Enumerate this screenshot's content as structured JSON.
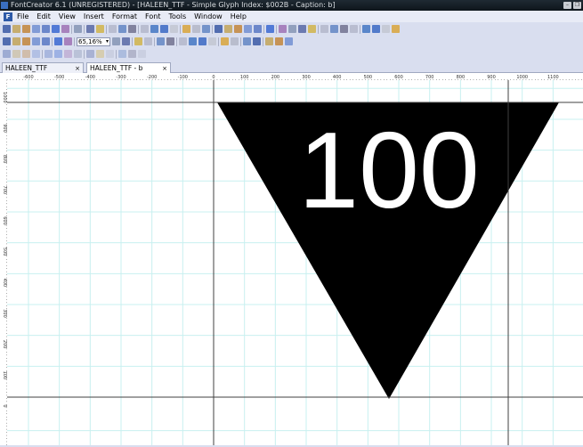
{
  "window": {
    "title": "FontCreator 6.1 (UNREGISTERED) - [HALEEN_TTF - Simple Glyph Index: $002B - Caption: b]",
    "minimize": "–",
    "restore": "❐"
  },
  "menu": {
    "logo": "F",
    "items": [
      "File",
      "Edit",
      "View",
      "Insert",
      "Format",
      "Font",
      "Tools",
      "Window",
      "Help"
    ]
  },
  "toolbar": {
    "zoom": "65,16%"
  },
  "tabs": [
    {
      "label": "HALEEN_TTF",
      "close": "×"
    },
    {
      "label": "HALEEN_TTF - b",
      "close": "×"
    }
  ],
  "ruler": {
    "h_labels": [
      "-600",
      "-500",
      "-400",
      "-300",
      "-200",
      "-100",
      "0",
      "100",
      "200",
      "300",
      "400",
      "500",
      "600",
      "700",
      "800",
      "900",
      "1000",
      "1100"
    ],
    "v_labels": [
      "1000",
      "900",
      "800",
      "700",
      "600",
      "500",
      "400",
      "300",
      "200",
      "100",
      "0"
    ]
  },
  "glyph": {
    "text": "100",
    "fill": "#000000",
    "text_color": "#ffffff"
  },
  "colors": {
    "grid": "#c8f0f0",
    "guide": "#404040"
  }
}
